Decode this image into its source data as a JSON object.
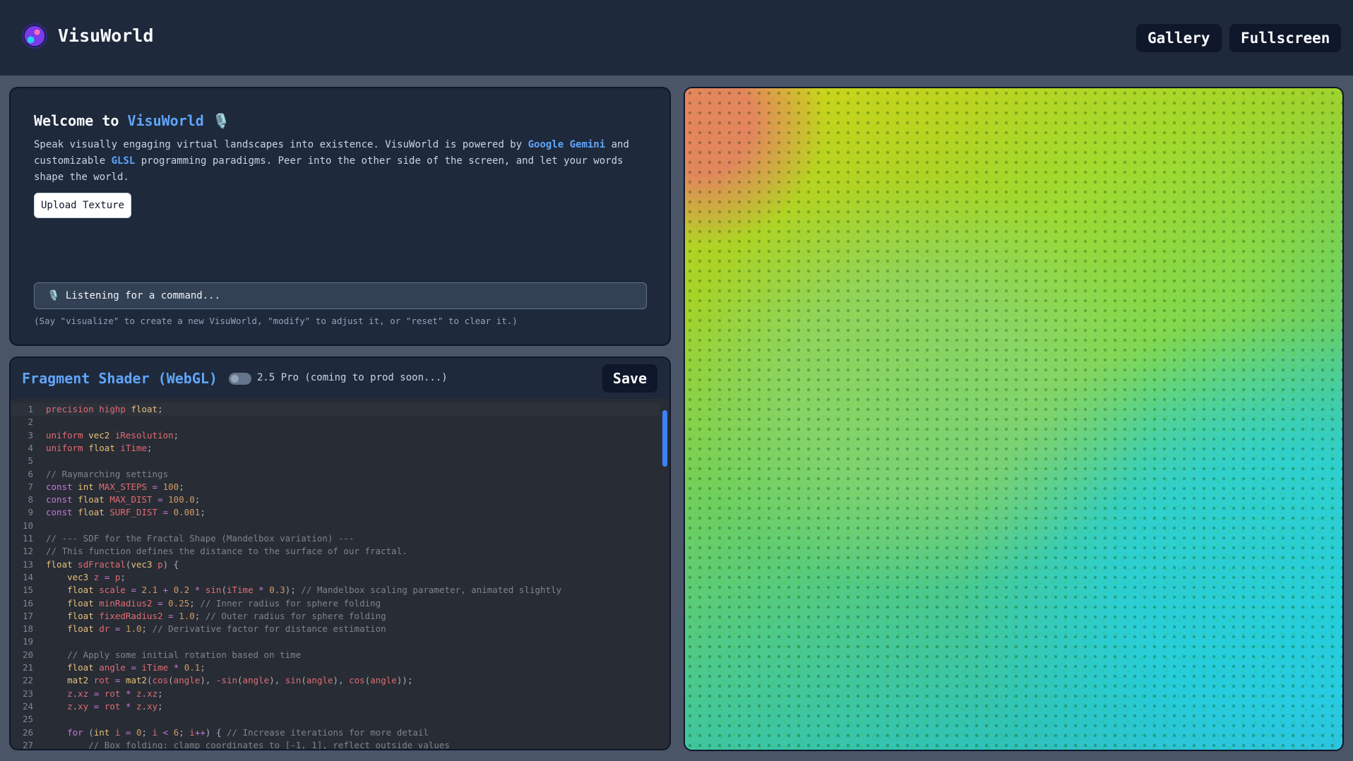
{
  "header": {
    "brand": "VisuWorld",
    "nav": [
      "Gallery",
      "Fullscreen"
    ]
  },
  "welcome": {
    "title_prefix": "Welcome to ",
    "title_brand": "VisuWorld",
    "title_icon": "🎙️",
    "body": [
      {
        "text": "Speak visually engaging virtual landscapes into existence. VisuWorld is powered by "
      },
      {
        "text": "Google Gemini",
        "highlight": true
      },
      {
        "text": " and customizable "
      },
      {
        "text": "GLSL",
        "highlight": true
      },
      {
        "text": " programming paradigms. Peer into the other side of the screen, and let your words shape the world."
      }
    ],
    "upload_label": "Upload Texture",
    "command_icon": "🎙️",
    "command_text": "Listening for a command...",
    "hint": "(Say \"visualize\" to create a new VisuWorld, \"modify\" to adjust it, or \"reset\" to clear it.)"
  },
  "editor": {
    "title": "Fragment Shader (WebGL)",
    "toggle_label": "2.5 Pro (coming to prod soon...)",
    "save_label": "Save",
    "lines": [
      "precision highp float;",
      "",
      "uniform vec2 iResolution;",
      "uniform float iTime;",
      "",
      "// Raymarching settings",
      "const int MAX_STEPS = 100;",
      "const float MAX_DIST = 100.0;",
      "const float SURF_DIST = 0.001;",
      "",
      "// --- SDF for the Fractal Shape (Mandelbox variation) ---",
      "// This function defines the distance to the surface of our fractal.",
      "float sdFractal(vec3 p) {",
      "    vec3 z = p;",
      "    float scale = 2.1 + 0.2 * sin(iTime * 0.3); // Mandelbox scaling parameter, animated slightly",
      "    float minRadius2 = 0.25; // Inner radius for sphere folding",
      "    float fixedRadius2 = 1.0; // Outer radius for sphere folding",
      "    float dr = 1.0; // Derivative factor for distance estimation",
      "",
      "    // Apply some initial rotation based on time",
      "    float angle = iTime * 0.1;",
      "    mat2 rot = mat2(cos(angle), -sin(angle), sin(angle), cos(angle));",
      "    z.xz = rot * z.xz;",
      "    z.xy = rot * z.xy;",
      "",
      "    for (int i = 0; i < 6; i++) { // Increase iterations for more detail",
      "        // Box folding: clamp coordinates to [-1, 1], reflect outside values"
    ]
  },
  "syntax_colors": {
    "keyword": "#c678dd",
    "type": "#e5c07b",
    "qualifier": "#e06c75",
    "number": "#d19a66",
    "function": "#e06c75",
    "comment": "#7f848e",
    "plain": "#abb2bf"
  },
  "colors": {
    "accent": "#60a5fa",
    "panel": "#1e293b",
    "page": "#4a5568"
  }
}
